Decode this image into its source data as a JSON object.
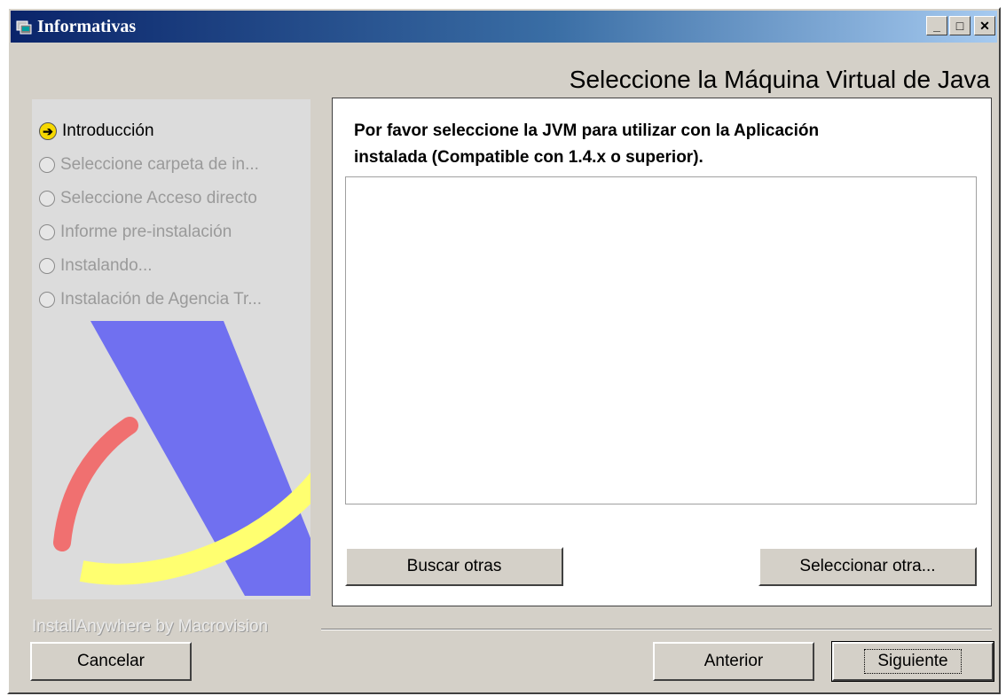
{
  "window": {
    "title": "Informativas",
    "controls": {
      "minimize": "_",
      "maximize": "□",
      "close": "✕"
    }
  },
  "header": {
    "title": "Seleccione la Máquina Virtual de  Java"
  },
  "steps": [
    {
      "label": "Introducción",
      "state": "current",
      "icon": "arrow-right-icon"
    },
    {
      "label": "Seleccione carpeta de in...",
      "state": "pending",
      "icon": "radio-icon"
    },
    {
      "label": "Seleccione  Acceso directo",
      "state": "pending",
      "icon": "radio-icon"
    },
    {
      "label": "Informe pre-instalación",
      "state": "pending",
      "icon": "radio-icon"
    },
    {
      "label": "Instalando...",
      "state": "pending",
      "icon": "radio-icon"
    },
    {
      "label": "Instalación de Agencia Tr...",
      "state": "pending",
      "icon": "radio-icon"
    }
  ],
  "content": {
    "instruction_line1": "Por favor seleccione  la  JVM para utilizar con la Aplicación",
    "instruction_line2": "instalada (Compatible con 1.4.x o superior).",
    "jvm_list": [],
    "buttons": {
      "search_other": "Buscar otras",
      "select_other": "Seleccionar otra..."
    }
  },
  "footer": {
    "brand": "InstallAnywhere by Macrovision",
    "buttons": {
      "cancel": "Cancelar",
      "previous": "Anterior",
      "next": "Siguiente"
    }
  },
  "colors": {
    "titlebar_start": "#0a246a",
    "titlebar_end": "#a6caf0",
    "face": "#d4d0c8",
    "logo_blue": "#7070f0",
    "logo_red": "#f07070",
    "logo_yellow": "#ffff70",
    "logo_dark_blue": "#0000e0"
  }
}
